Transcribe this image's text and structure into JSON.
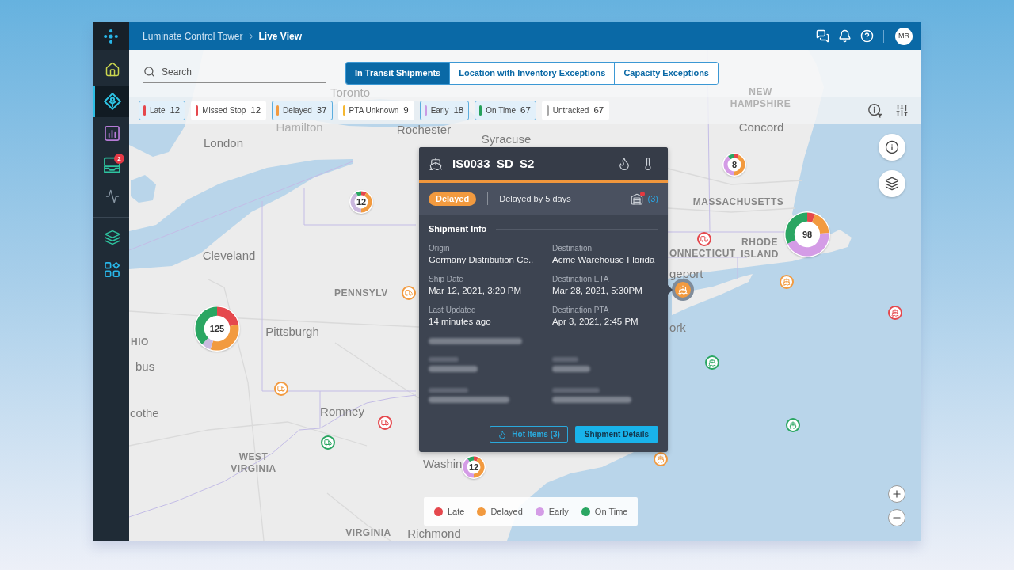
{
  "header": {
    "app_name": "Luminate Control Tower",
    "page": "Live View",
    "avatar": "MR"
  },
  "sidebar": {
    "items": [
      {
        "selected": false
      },
      {
        "selected": true
      },
      {
        "selected": false
      },
      {
        "selected": false,
        "badge": "2"
      },
      {
        "selected": false
      }
    ]
  },
  "search": {
    "placeholder": "Search"
  },
  "tabs": [
    {
      "label": "In Transit Shipments",
      "selected": true
    },
    {
      "label": "Location with Inventory Exceptions",
      "selected": false
    },
    {
      "label": "Capacity Exceptions",
      "selected": false
    }
  ],
  "filters": [
    {
      "label": "Late",
      "count": "12",
      "color": "#e5484d",
      "selected": true
    },
    {
      "label": "Missed Stop",
      "count": "12",
      "color": "#e5484d",
      "selected": false
    },
    {
      "label": "Delayed",
      "count": "37",
      "color": "#f29a3f",
      "selected": true
    },
    {
      "label": "PTA Unknown",
      "count": "9",
      "color": "#f5b731",
      "selected": false
    },
    {
      "label": "Early",
      "count": "18",
      "color": "#c99be3",
      "selected": true
    },
    {
      "label": "On Time",
      "count": "67",
      "color": "#27a15b",
      "selected": true
    },
    {
      "label": "Untracked",
      "count": "67",
      "color": "#a8a8a8",
      "selected": false
    }
  ],
  "map": {
    "places": [
      {
        "name": "Toronto",
        "kind": "city"
      },
      {
        "name": "Hamilton",
        "kind": "city"
      },
      {
        "name": "London",
        "kind": "city"
      },
      {
        "name": "Rochester",
        "kind": "city"
      },
      {
        "name": "Syracuse",
        "kind": "city"
      },
      {
        "name": "NEW HAMPSHIRE",
        "kind": "region"
      },
      {
        "name": "Concord",
        "kind": "city"
      },
      {
        "name": "MASSACHUSETTS",
        "kind": "region"
      },
      {
        "name": "Cleveland",
        "kind": "city"
      },
      {
        "name": "ONNECTICUT",
        "kind": "region"
      },
      {
        "name": "RHODE ISLAND",
        "kind": "region"
      },
      {
        "name": "geport",
        "kind": "city"
      },
      {
        "name": "PENNSYLV",
        "kind": "region"
      },
      {
        "name": "Pittsburgh",
        "kind": "city"
      },
      {
        "name": "ork",
        "kind": "city"
      },
      {
        "name": "HIO",
        "kind": "region"
      },
      {
        "name": "bus",
        "kind": "city"
      },
      {
        "name": "cothe",
        "kind": "city"
      },
      {
        "name": "Romney",
        "kind": "city"
      },
      {
        "name": "WEST VIRGINIA",
        "kind": "region"
      },
      {
        "name": "Washin",
        "kind": "city"
      },
      {
        "name": "VIRGINIA",
        "kind": "region"
      },
      {
        "name": "Richmond",
        "kind": "city"
      }
    ],
    "clusters": [
      {
        "count": "12"
      },
      {
        "count": "125"
      },
      {
        "count": "8"
      },
      {
        "count": "98"
      },
      {
        "count": "12"
      }
    ],
    "markers": [
      {
        "kind": "truck",
        "color": "#f29a3f",
        "selected": false
      },
      {
        "kind": "truck",
        "color": "#f29a3f",
        "selected": false
      },
      {
        "kind": "truck",
        "color": "#e5484d",
        "selected": false
      },
      {
        "kind": "truck",
        "color": "#2aa662",
        "selected": false
      },
      {
        "kind": "truck",
        "color": "#e5484d",
        "selected": false
      },
      {
        "kind": "ship",
        "color": "#f29a3f",
        "selected": false
      },
      {
        "kind": "ship",
        "color": "#f29a3f",
        "selected": true
      },
      {
        "kind": "ship",
        "color": "#e5484d",
        "selected": false
      },
      {
        "kind": "ship",
        "color": "#2aa662",
        "selected": false
      },
      {
        "kind": "ship",
        "color": "#2aa662",
        "selected": false
      },
      {
        "kind": "ship",
        "color": "#f29a3f",
        "selected": false
      }
    ]
  },
  "popup": {
    "title": "IS0033_SD_S2",
    "status": "Delayed",
    "status_note": "Delayed by 5 days",
    "alert_count": "(3)",
    "section": "Shipment Info",
    "fields": [
      {
        "label": "Origin",
        "value": "Germany Distribution Ce.."
      },
      {
        "label": "Destination",
        "value": "Acme Warehouse Florida"
      },
      {
        "label": "Ship Date",
        "value": "Mar 12, 2021, 3:20 PM"
      },
      {
        "label": "Destination ETA",
        "value": "Mar 28, 2021, 5:30PM"
      },
      {
        "label": "Last Updated",
        "value": "14 minutes ago"
      },
      {
        "label": "Destination PTA",
        "value": "Apr 3, 2021, 2:45 PM"
      }
    ],
    "buttons": [
      {
        "label": "Hot Items (3)",
        "kind": "outline"
      },
      {
        "label": "Shipment Details",
        "kind": "primary"
      }
    ]
  },
  "legend": [
    {
      "label": "Late",
      "color": "#e5484d"
    },
    {
      "label": "Delayed",
      "color": "#f29a3f"
    },
    {
      "label": "Early",
      "color": "#d49ce6"
    },
    {
      "label": "On Time",
      "color": "#2aa662"
    }
  ]
}
